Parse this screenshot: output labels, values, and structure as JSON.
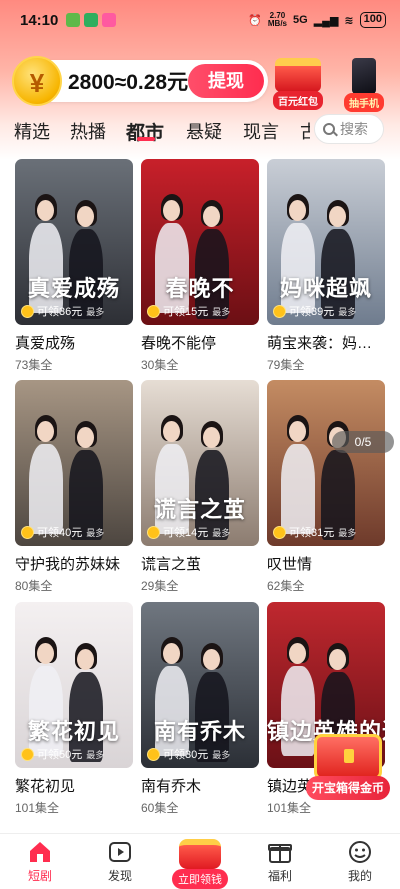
{
  "status_bar": {
    "time": "14:10",
    "net_speed": "2.70",
    "net_unit": "MB/s",
    "signal_label": "5G",
    "battery": "100"
  },
  "coin_banner": {
    "coin_symbol": "¥",
    "balance_text": "2800≈0.28元",
    "withdraw_label": "提现"
  },
  "promos": [
    {
      "label": "百元红包",
      "icon": "red-envelope-icon"
    },
    {
      "label": "抽手机",
      "icon": "phone-icon"
    }
  ],
  "tabs": [
    "精选",
    "热播",
    "都市",
    "悬疑",
    "现言",
    "古"
  ],
  "active_tab": "都市",
  "search": {
    "placeholder": "搜索"
  },
  "dramas": [
    {
      "title": "真爱成殇",
      "episodes": "73集全",
      "reward": "可领36元",
      "more": "最多",
      "poster_title": "真爱成殇",
      "colors": [
        "#2d2f35",
        "#6a7078"
      ]
    },
    {
      "title": "春晚不能停",
      "episodes": "30集全",
      "reward": "可领15元",
      "more": "最多",
      "poster_title": "春晚不",
      "colors": [
        "#6b0f14",
        "#c8202a"
      ]
    },
    {
      "title": "萌宝来袭：妈…",
      "episodes": "79集全",
      "reward": "可领39元",
      "more": "最多",
      "poster_title": "妈咪超飒",
      "colors": [
        "#6f7c8e",
        "#c9ced6"
      ]
    },
    {
      "title": "守护我的苏妹妹",
      "episodes": "80集全",
      "reward": "可领40元",
      "more": "最多",
      "poster_title": "",
      "colors": [
        "#4d4640",
        "#a79684"
      ]
    },
    {
      "title": "谎言之茧",
      "episodes": "29集全",
      "reward": "可领14元",
      "more": "最多",
      "poster_title": "谎言之茧",
      "colors": [
        "#8c7c70",
        "#e6ddd4"
      ]
    },
    {
      "title": "叹世情",
      "episodes": "62集全",
      "reward": "可领31元",
      "more": "最多",
      "poster_title": "",
      "colors": [
        "#6e3a2b",
        "#c48c63"
      ]
    },
    {
      "title": "繁花初见",
      "episodes": "101集全",
      "reward": "可领50元",
      "more": "最多",
      "poster_title": "繁花初见",
      "colors": [
        "#d9d4d6",
        "#f4f0f1"
      ]
    },
    {
      "title": "南有乔木",
      "episodes": "60集全",
      "reward": "可领30元",
      "more": "最多",
      "poster_title": "南有乔木",
      "colors": [
        "#2b2f36",
        "#707780"
      ]
    },
    {
      "title": "镇边英雄的迟情救赎",
      "episodes": "101集全",
      "reward": "",
      "more": "",
      "poster_title": "镇边英雄的迟情救赎",
      "colors": [
        "#6b1016",
        "#c0282f"
      ]
    }
  ],
  "counter": "0/5",
  "treasure": {
    "label": "开宝箱得金币"
  },
  "bottom_nav": [
    {
      "label": "短剧",
      "icon": "home-icon",
      "active": true
    },
    {
      "label": "发现",
      "icon": "play-icon",
      "active": false
    },
    {
      "label": "立即领钱",
      "icon": "red-envelope-icon",
      "active": false
    },
    {
      "label": "福利",
      "icon": "gift-icon",
      "active": false
    },
    {
      "label": "我的",
      "icon": "profile-icon",
      "active": false
    }
  ],
  "colors": {
    "accent": "#ff2d4f",
    "gold": "#f7b500"
  }
}
